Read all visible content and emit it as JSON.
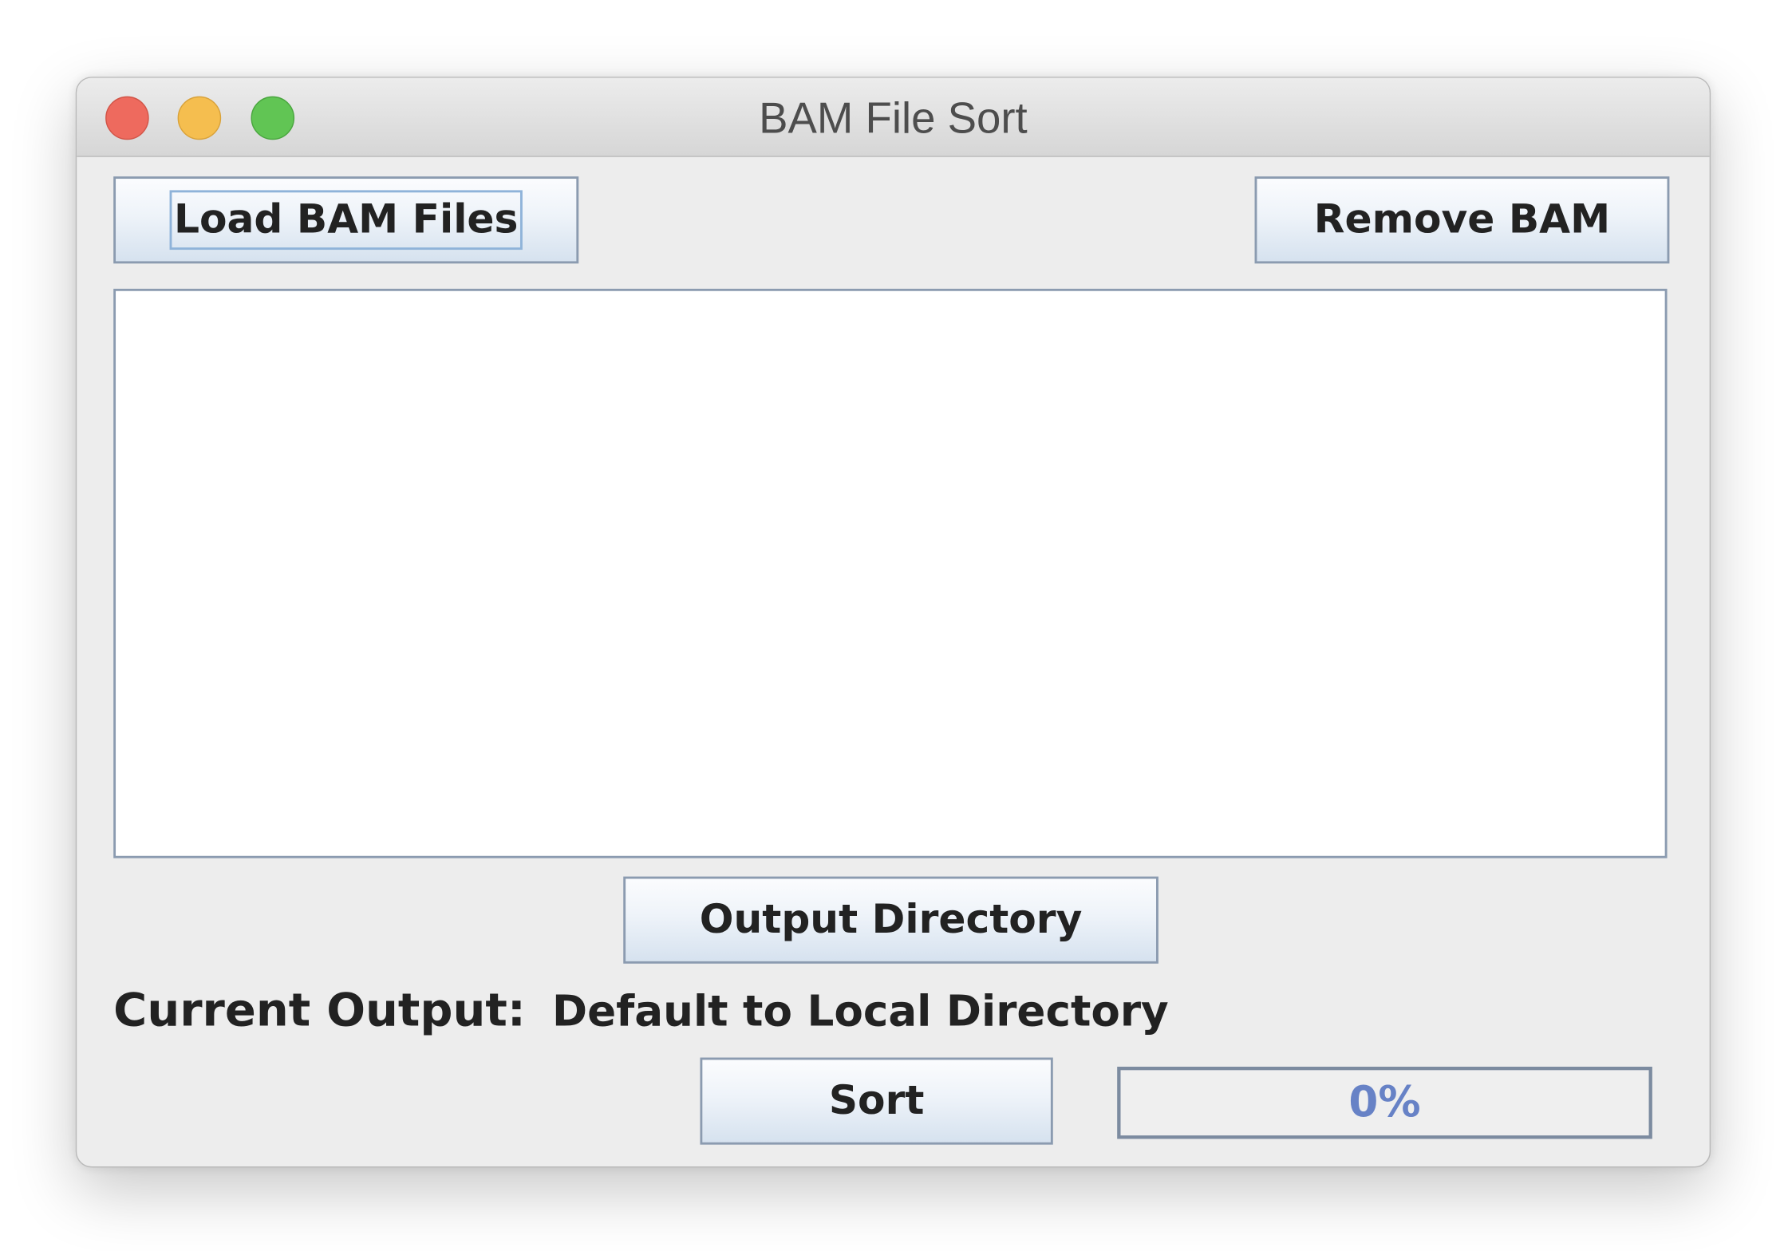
{
  "window": {
    "title": "BAM File Sort"
  },
  "title_buttons": [
    "close",
    "minimize",
    "zoom"
  ],
  "toolbar": {
    "load_label": "Load BAM Files",
    "remove_label": "Remove BAM"
  },
  "file_list": {
    "items": []
  },
  "output": {
    "button_label": "Output Directory",
    "current_label": "Current Output:",
    "current_value": "Default to Local Directory"
  },
  "actions": {
    "sort_label": "Sort"
  },
  "progress": {
    "value": 0,
    "text": "0%"
  },
  "colors": {
    "window_bg": "#ededed",
    "close": "#ee6a5e",
    "minimize": "#f5be4f",
    "zoom": "#61c554",
    "progress_text": "#6782c6",
    "button_border": "#8b9bb0"
  }
}
